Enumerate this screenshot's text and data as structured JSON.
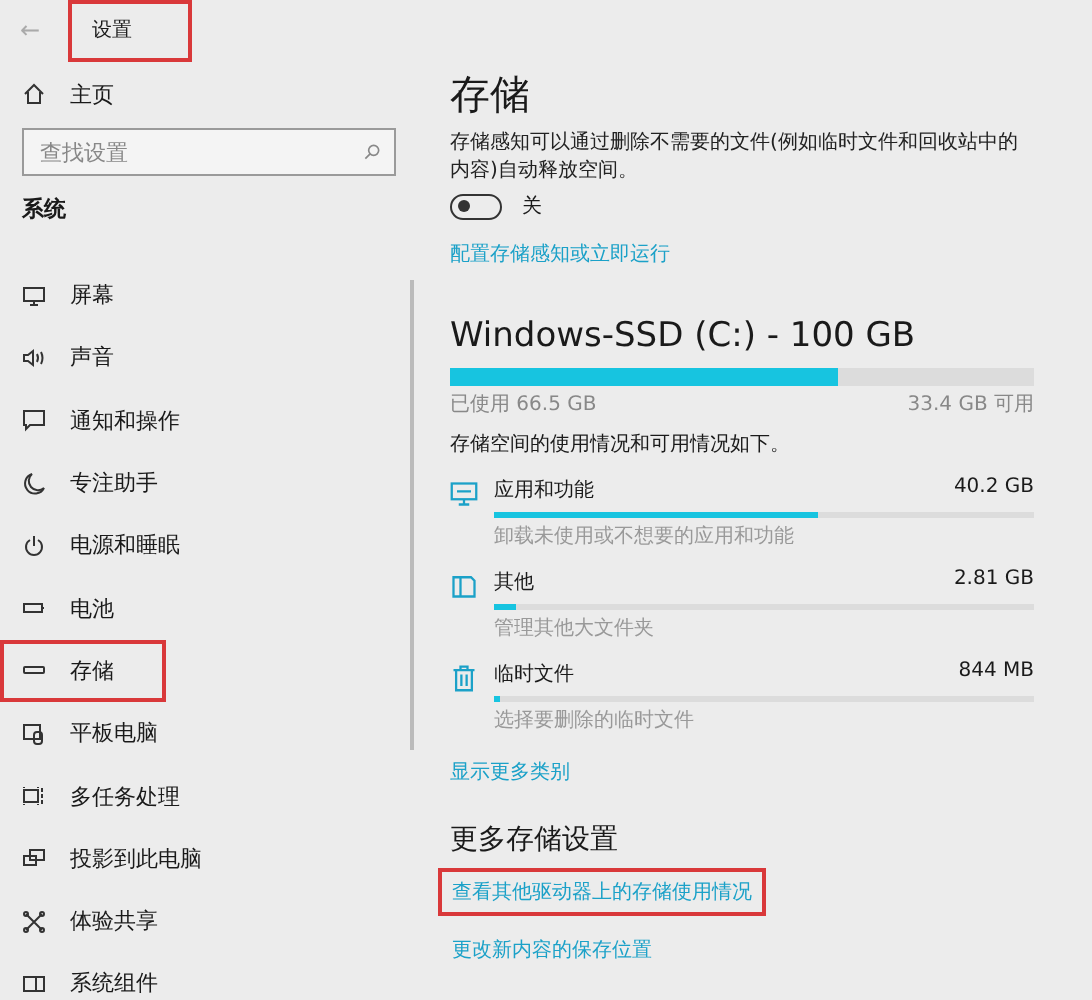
{
  "window": {
    "title": "设置",
    "title_highlighted": true,
    "back": "←"
  },
  "sidebar": {
    "home": "主页",
    "search": {
      "placeholder": "查找设置"
    },
    "section": "系统",
    "items": [
      {
        "label": "屏幕",
        "highlighted": false
      },
      {
        "label": "声音",
        "highlighted": false
      },
      {
        "label": "通知和操作",
        "highlighted": false
      },
      {
        "label": "专注助手",
        "highlighted": false
      },
      {
        "label": "电源和睡眠",
        "highlighted": false
      },
      {
        "label": "电池",
        "highlighted": false
      },
      {
        "label": "存储",
        "highlighted": true
      },
      {
        "label": "平板电脑",
        "highlighted": false
      },
      {
        "label": "多任务处理",
        "highlighted": false
      },
      {
        "label": "投影到此电脑",
        "highlighted": false
      },
      {
        "label": "体验共享",
        "highlighted": false
      },
      {
        "label": "系统组件",
        "highlighted": false
      }
    ]
  },
  "main": {
    "title": "存储",
    "description": "存储感知可以通过删除不需要的文件(例如临时文件和回收站中的内容)自动释放空间。",
    "toggle": {
      "on": false,
      "label": "关"
    },
    "configure_link": "配置存储感知或立即运行",
    "drive": {
      "name": "Windows-SSD (C:) - 100 GB",
      "level": 0.665,
      "used": "已使用 66.5 GB",
      "free": "33.4 GB 可用"
    },
    "summary": "存储空间的使用情况和可用情况如下。",
    "categories": [
      {
        "name": "应用和功能",
        "size": "40.2 GB",
        "level": 0.6,
        "hint": "卸载未使用或不想要的应用和功能"
      },
      {
        "name": "其他",
        "size": "2.81 GB",
        "level": 0.04,
        "hint": "管理其他大文件夹"
      },
      {
        "name": "临时文件",
        "size": "844 MB",
        "level": 0.012,
        "hint": "选择要删除的临时文件"
      }
    ],
    "show_more": "显示更多类别",
    "more_title": "更多存储设置",
    "links": [
      {
        "label": "查看其他驱动器上的存储使用情况",
        "highlighted": true
      },
      {
        "label": "更改新内容的保存位置",
        "highlighted": false
      }
    ]
  }
}
